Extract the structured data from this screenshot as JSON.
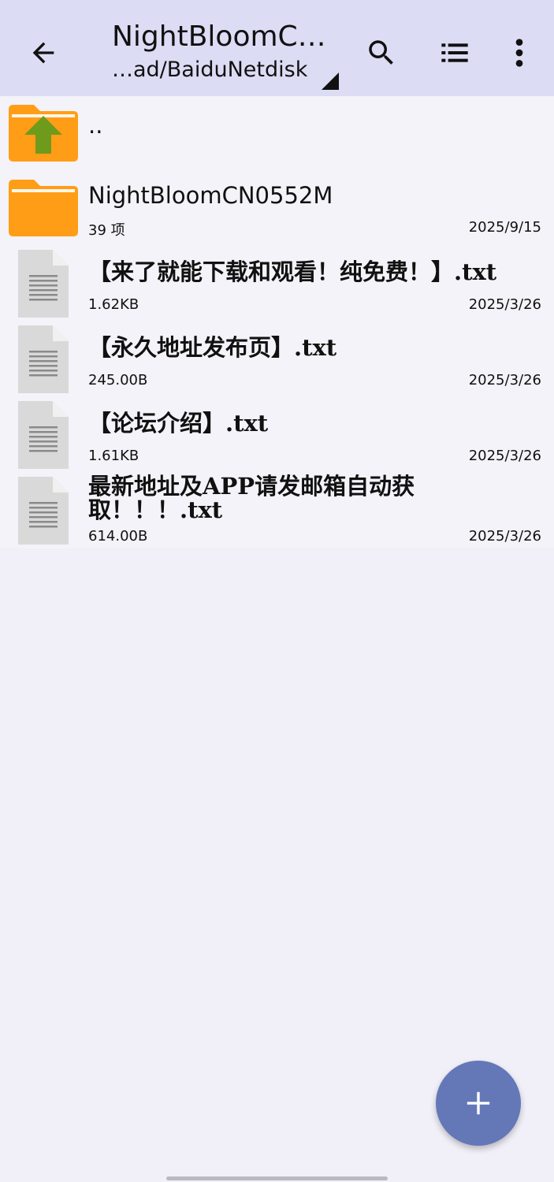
{
  "header": {
    "title": "NightBloomC…",
    "subtitle": "…ad/BaiduNetdisk"
  },
  "icons": {
    "back": "arrow-left-icon",
    "search": "search-icon",
    "view": "list-view-icon",
    "more": "more-vert-icon",
    "add": "plus-icon"
  },
  "files": {
    "parent": {
      "name": ".."
    },
    "items": [
      {
        "name": "NightBloomCN0552M",
        "meta": "39 项",
        "date": "2025/9/15",
        "type": "folder"
      },
      {
        "name": "【来了就能下载和观看！纯免费！】.txt",
        "meta": "1.62KB",
        "date": "2025/3/26",
        "type": "txt"
      },
      {
        "name": "【永久地址发布页】.txt",
        "meta": "245.00B",
        "date": "2025/3/26",
        "type": "txt"
      },
      {
        "name": "【论坛介绍】.txt",
        "meta": "1.61KB",
        "date": "2025/3/26",
        "type": "txt"
      },
      {
        "name": "最新地址及APP请发邮箱自动获取！！！.txt",
        "meta": "614.00B",
        "date": "2025/3/26",
        "type": "txt"
      }
    ]
  },
  "colors": {
    "topbar": "#dcdcf4",
    "folder": "#ff9e16",
    "upArrow": "#6e9b1c",
    "fab": "#6478b8"
  }
}
